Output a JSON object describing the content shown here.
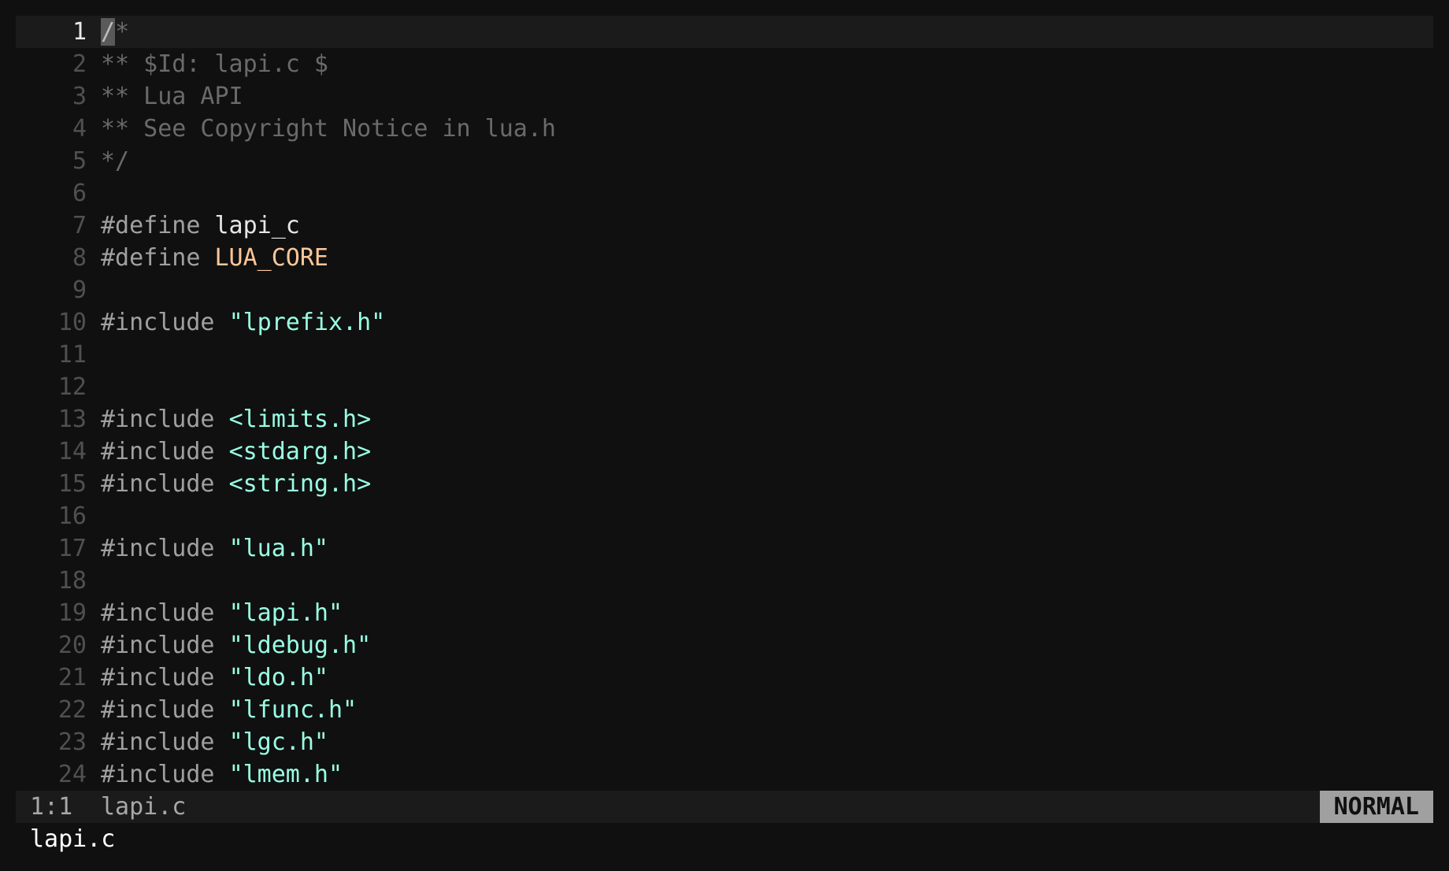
{
  "window": {
    "title": "lapi.c"
  },
  "editor": {
    "current_line": 1,
    "lines": [
      {
        "n": "1",
        "parts": [
          {
            "t": "/",
            "c": "cursor"
          },
          {
            "t": "*",
            "c": "comment"
          }
        ]
      },
      {
        "n": "2",
        "parts": [
          {
            "t": "** $Id: lapi.c $",
            "c": "comment"
          }
        ]
      },
      {
        "n": "3",
        "parts": [
          {
            "t": "** Lua API",
            "c": "comment"
          }
        ]
      },
      {
        "n": "4",
        "parts": [
          {
            "t": "** See Copyright Notice in lua.h",
            "c": "comment"
          }
        ]
      },
      {
        "n": "5",
        "parts": [
          {
            "t": "*/",
            "c": "comment"
          }
        ]
      },
      {
        "n": "6",
        "parts": []
      },
      {
        "n": "7",
        "parts": [
          {
            "t": "#define ",
            "c": "kw"
          },
          {
            "t": "lapi_c",
            "c": "ident"
          }
        ]
      },
      {
        "n": "8",
        "parts": [
          {
            "t": "#define ",
            "c": "kw"
          },
          {
            "t": "LUA_CORE",
            "c": "macro"
          }
        ]
      },
      {
        "n": "9",
        "parts": []
      },
      {
        "n": "10",
        "parts": [
          {
            "t": "#include ",
            "c": "kw"
          },
          {
            "t": "\"lprefix.h\"",
            "c": "str"
          }
        ]
      },
      {
        "n": "11",
        "parts": []
      },
      {
        "n": "12",
        "parts": []
      },
      {
        "n": "13",
        "parts": [
          {
            "t": "#include ",
            "c": "kw"
          },
          {
            "t": "<limits.h>",
            "c": "str"
          }
        ]
      },
      {
        "n": "14",
        "parts": [
          {
            "t": "#include ",
            "c": "kw"
          },
          {
            "t": "<stdarg.h>",
            "c": "str"
          }
        ]
      },
      {
        "n": "15",
        "parts": [
          {
            "t": "#include ",
            "c": "kw"
          },
          {
            "t": "<string.h>",
            "c": "str"
          }
        ]
      },
      {
        "n": "16",
        "parts": []
      },
      {
        "n": "17",
        "parts": [
          {
            "t": "#include ",
            "c": "kw"
          },
          {
            "t": "\"lua.h\"",
            "c": "str"
          }
        ]
      },
      {
        "n": "18",
        "parts": []
      },
      {
        "n": "19",
        "parts": [
          {
            "t": "#include ",
            "c": "kw"
          },
          {
            "t": "\"lapi.h\"",
            "c": "str"
          }
        ]
      },
      {
        "n": "20",
        "parts": [
          {
            "t": "#include ",
            "c": "kw"
          },
          {
            "t": "\"ldebug.h\"",
            "c": "str"
          }
        ]
      },
      {
        "n": "21",
        "parts": [
          {
            "t": "#include ",
            "c": "kw"
          },
          {
            "t": "\"ldo.h\"",
            "c": "str"
          }
        ]
      },
      {
        "n": "22",
        "parts": [
          {
            "t": "#include ",
            "c": "kw"
          },
          {
            "t": "\"lfunc.h\"",
            "c": "str"
          }
        ]
      },
      {
        "n": "23",
        "parts": [
          {
            "t": "#include ",
            "c": "kw"
          },
          {
            "t": "\"lgc.h\"",
            "c": "str"
          }
        ]
      },
      {
        "n": "24",
        "parts": [
          {
            "t": "#include ",
            "c": "kw"
          },
          {
            "t": "\"lmem.h\"",
            "c": "str"
          }
        ]
      }
    ]
  },
  "statusline": {
    "position": "1:1",
    "filename": "lapi.c",
    "mode": "NORMAL"
  },
  "cmdline": {
    "text": "lapi.c"
  },
  "colors": {
    "background": "#101010",
    "current_line_bg": "#1b1b1b",
    "comment": "#6a6a6a",
    "keyword": "#a0a0a0",
    "identifier": "#e6e6e6",
    "macro": "#ffc799",
    "string": "#99ffe4",
    "mode_badge_bg": "#a0a0a0"
  }
}
